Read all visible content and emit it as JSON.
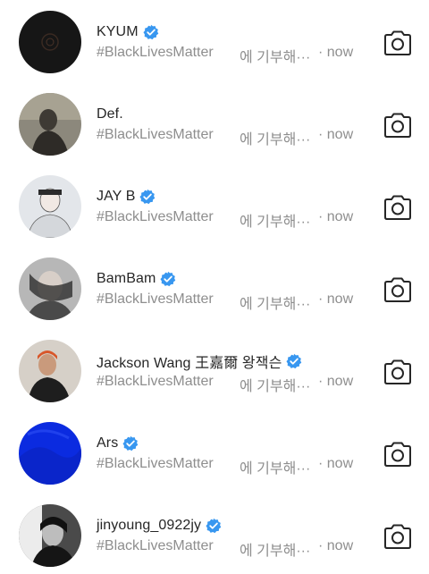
{
  "notifications": [
    {
      "name": "KYUM",
      "verified": true,
      "hashtag": "#BlackLivesMatter",
      "text": "에 기부해···",
      "time": "· now",
      "avatar_color": "#1a1a1a"
    },
    {
      "name": "Def.",
      "verified": false,
      "hashtag": "#BlackLivesMatter",
      "text": "에 기부해···",
      "time": "· now",
      "avatar_color": "#6e6b62"
    },
    {
      "name": "JAY B",
      "verified": true,
      "hashtag": "#BlackLivesMatter",
      "text": "에 기부해···",
      "time": "· now",
      "avatar_color": "#c9cfd6"
    },
    {
      "name": "BamBam",
      "verified": true,
      "hashtag": "#BlackLivesMatter",
      "text": "에 기부해···",
      "time": "· now",
      "avatar_color": "#9a9a9a"
    },
    {
      "name": "Jackson Wang 王嘉爾 왕잭슨",
      "verified": true,
      "hashtag": "#BlackLivesMatter",
      "text": "에 기부해···",
      "time": "· now",
      "avatar_color": "#c9c3bb"
    },
    {
      "name": "Ars",
      "verified": true,
      "hashtag": "#BlackLivesMatter",
      "text": "에 기부해···",
      "time": "· now",
      "avatar_color": "#0a2bdc"
    },
    {
      "name": "jinyoung_0922jy",
      "verified": true,
      "hashtag": "#BlackLivesMatter",
      "text": "에 기부해···",
      "time": "· now",
      "avatar_color": "#3a3a3a"
    }
  ],
  "icons": {
    "verified": "verified-badge-icon",
    "camera": "camera-icon"
  },
  "colors": {
    "verified_blue": "#3897f0",
    "secondary_text": "#8e8e8e",
    "primary_text": "#262626"
  }
}
